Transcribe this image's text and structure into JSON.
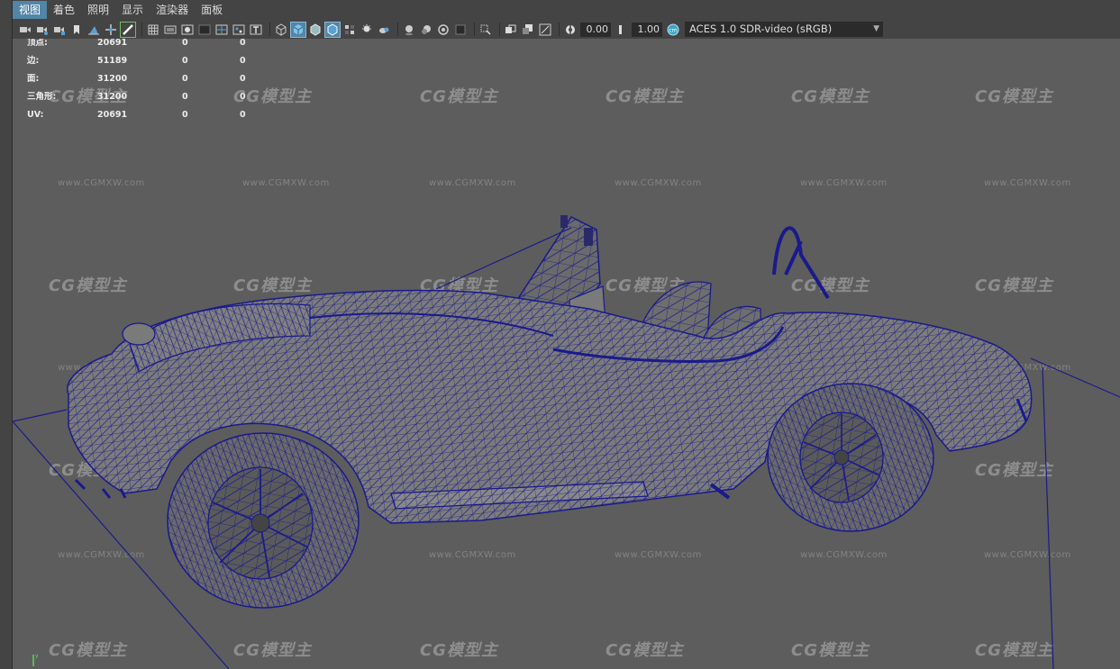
{
  "menu": {
    "items": [
      {
        "label": "视图",
        "active": true
      },
      {
        "label": "着色",
        "active": false
      },
      {
        "label": "照明",
        "active": false
      },
      {
        "label": "显示",
        "active": false
      },
      {
        "label": "渲染器",
        "active": false
      },
      {
        "label": "面板",
        "active": false
      }
    ]
  },
  "toolbar": {
    "exposure_value": "0.00",
    "gamma_value": "1.00",
    "color_space": "ACES 1.0 SDR-video (sRGB)",
    "icons": [
      "camera-icon",
      "camera-lock-icon",
      "camera-attr-icon",
      "bookmark-icon",
      "image-plane-icon",
      "move-icon",
      "grease-pencil-icon",
      "grid-icon",
      "film-gate-icon",
      "resolution-gate-icon",
      "gate-mask-icon",
      "field-chart-icon",
      "safe-action-icon",
      "safe-title-icon",
      "wireframe-icon",
      "smooth-shade-icon",
      "wireframe-on-shaded-icon",
      "textured-icon",
      "use-all-lights-icon",
      "shadows-icon",
      "ambient-occlusion-icon",
      "motion-blur-icon",
      "anti-alias-icon",
      "depth-of-field-icon",
      "isolate-select-icon",
      "xray-icon",
      "xray-joints-icon",
      "xray-components-icon",
      "exposure-icon",
      "gamma-icon",
      "color-management-icon"
    ]
  },
  "hud": {
    "rows": [
      {
        "label": "顶点:",
        "v1": "20691",
        "v2": "0",
        "v3": "0"
      },
      {
        "label": "边:",
        "v1": "51189",
        "v2": "0",
        "v3": "0"
      },
      {
        "label": "面:",
        "v1": "31200",
        "v2": "0",
        "v3": "0"
      },
      {
        "label": "三角形:",
        "v1": "31200",
        "v2": "0",
        "v3": "0"
      },
      {
        "label": "UV:",
        "v1": "20691",
        "v2": "0",
        "v3": "0"
      }
    ]
  },
  "watermark": {
    "logo": "CG模型主",
    "url": "www.CGMXW.com"
  },
  "colors": {
    "wireframe": "#1a1a8c",
    "viewport_bg": "#5d5d5d",
    "menu_active": "#5285a6"
  }
}
